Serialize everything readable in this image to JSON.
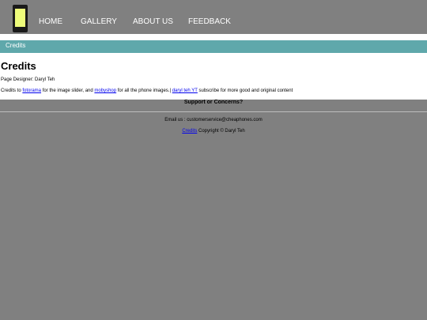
{
  "nav": {
    "items": [
      {
        "label": "HOME"
      },
      {
        "label": "GALLERY"
      },
      {
        "label": "ABOUT US"
      },
      {
        "label": "FEEDBACK"
      }
    ],
    "logo_icon": "phone-icon",
    "logo_colors": {
      "body": "#1a1a1a",
      "screen": "#eefc7a"
    }
  },
  "banner": {
    "label": "Credits",
    "color": "#5fa8ab"
  },
  "main": {
    "title": "Credits",
    "designer": "Page Designer: Daryl Teh",
    "credits": {
      "prefix": "Credits to ",
      "link1": "fotorama",
      "mid1": " for the image slider, and ",
      "link2": "mobyshop",
      "mid2": " for all the phone images.| ",
      "link3": "daryl teh YT",
      "suffix": " subscribe for more good and original content"
    }
  },
  "footer": {
    "support_title": "Support or Concerns?",
    "email": "Email us : customerservice@cheaphones.com",
    "credits_link": "Credits",
    "copyright": " Copyright © Daryl Teh"
  },
  "colors": {
    "background": "#808080",
    "link": "#0000ee"
  }
}
